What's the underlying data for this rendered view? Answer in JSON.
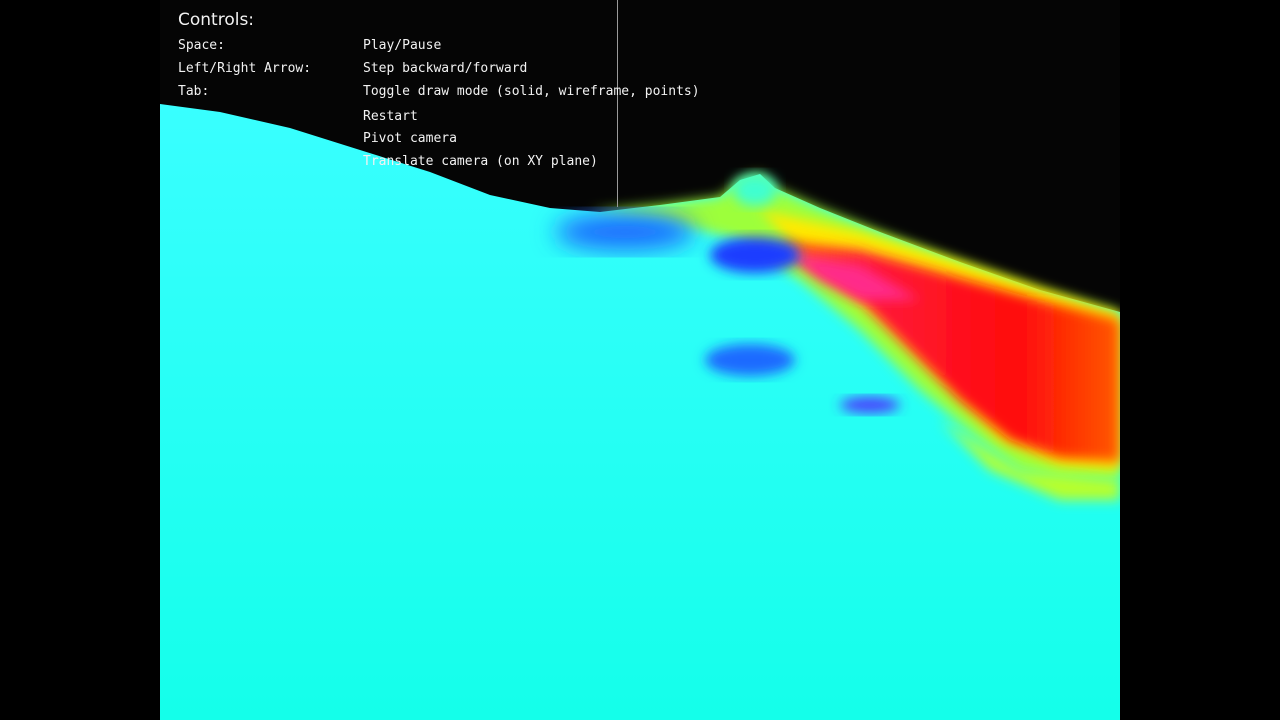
{
  "app": {
    "overlay_title": "Controls:",
    "controls": [
      {
        "key": "Space:",
        "action": "Play/Pause"
      },
      {
        "key": "Left/Right Arrow:",
        "action": "Step backward/forward"
      },
      {
        "key": "Tab:",
        "action": "Toggle draw mode (solid, wireframe, points)"
      },
      {
        "key": "",
        "action": "Restart"
      },
      {
        "key": "",
        "action": "Pivot camera"
      },
      {
        "key": "",
        "action": "Translate camera (on XY plane)"
      },
      {
        "key": "",
        "action": ""
      }
    ]
  },
  "render": {
    "background_color": "#000000",
    "colormap": [
      "#00ffff",
      "#1e6bff",
      "#ffff00",
      "#ff0000",
      "#ff2a8a"
    ]
  }
}
